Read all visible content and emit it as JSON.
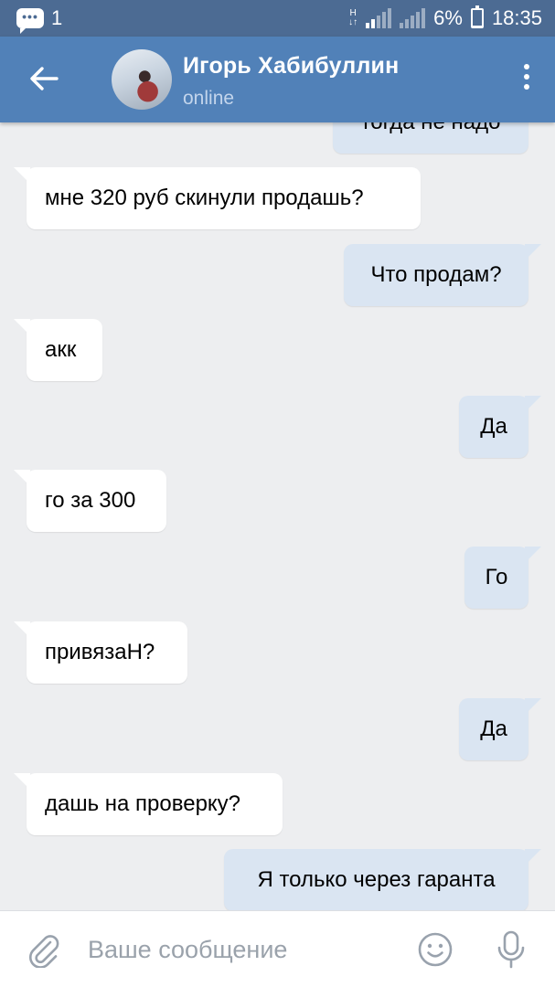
{
  "status_bar": {
    "notification_icon": "message-icon",
    "notification_count": "1",
    "network_type": "H",
    "battery_percent": "6%",
    "battery_level": 0.06,
    "time": "18:35"
  },
  "header": {
    "back_icon": "arrow-left-icon",
    "contact_name": "Игорь Хабибуллин",
    "contact_status": "online",
    "menu_icon": "more-vertical-icon"
  },
  "messages": [
    {
      "direction": "out",
      "text": "тогда не надо"
    },
    {
      "direction": "in",
      "text": "мне 320 руб скинули продашь?"
    },
    {
      "direction": "out",
      "text": "Что продам?"
    },
    {
      "direction": "in",
      "text": "акк"
    },
    {
      "direction": "out",
      "text": "Да"
    },
    {
      "direction": "in",
      "text": "го за 300"
    },
    {
      "direction": "out",
      "text": "Го"
    },
    {
      "direction": "in",
      "text": "привязаН?"
    },
    {
      "direction": "out",
      "text": "Да"
    },
    {
      "direction": "in",
      "text": "дашь на проверку?"
    },
    {
      "direction": "out",
      "text": "Я только через гаранта"
    }
  ],
  "composer": {
    "attach_icon": "paperclip-icon",
    "placeholder": "Ваше сообщение",
    "value": "",
    "emoji_icon": "smiley-icon",
    "mic_icon": "microphone-icon"
  },
  "colors": {
    "status_bar": "#4c6b93",
    "header": "#5181b8",
    "background": "#edeef0",
    "incoming_bubble": "#ffffff",
    "outgoing_bubble": "#dae5f2"
  }
}
